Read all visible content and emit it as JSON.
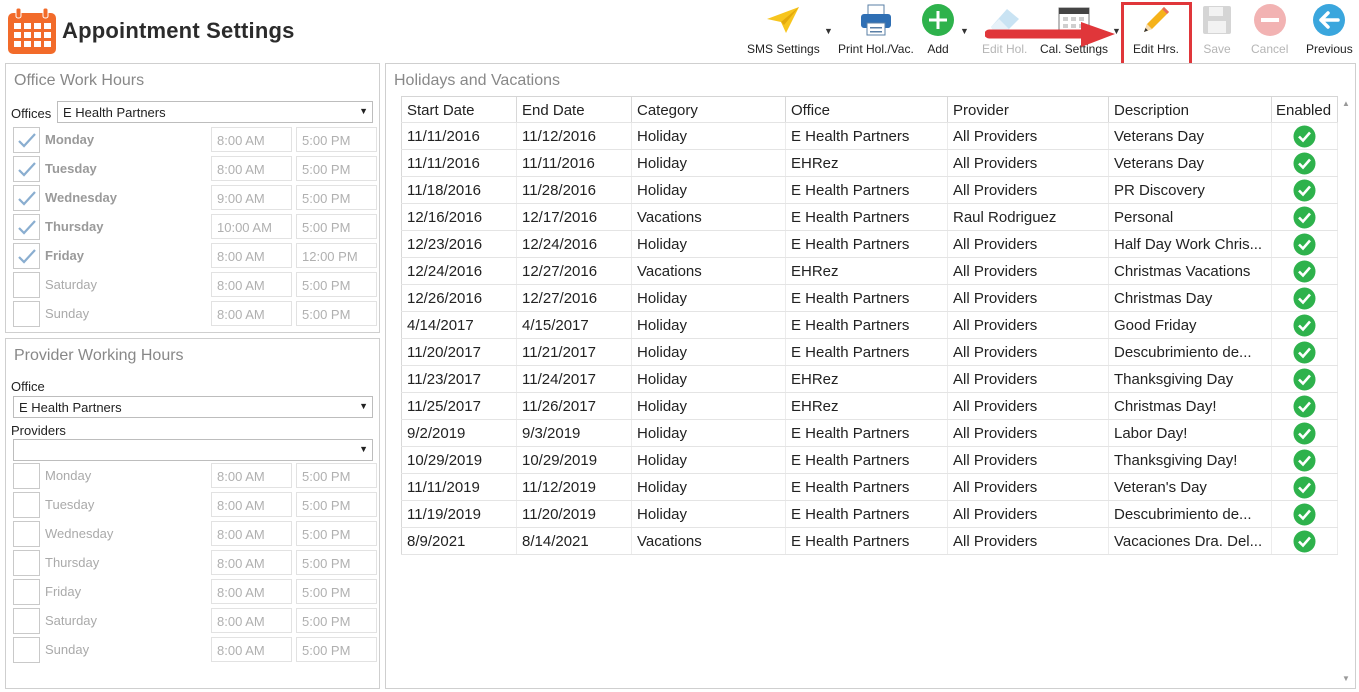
{
  "header": {
    "title": "Appointment Settings"
  },
  "toolbar": [
    {
      "label": "SMS Settings",
      "icon": "paper-plane-icon",
      "enabled": true
    },
    {
      "label": "Print Hol./Vac.",
      "icon": "printer-icon",
      "enabled": true
    },
    {
      "label": "Add",
      "icon": "plus-circle-icon",
      "enabled": true
    },
    {
      "label": "Edit Hol.",
      "icon": "eraser-icon",
      "enabled": false
    },
    {
      "label": "Cal. Settings",
      "icon": "calendar-settings-icon",
      "enabled": true
    },
    {
      "label": "Edit Hrs.",
      "icon": "pencil-icon",
      "enabled": true
    },
    {
      "label": "Save",
      "icon": "floppy-disk-icon",
      "enabled": false
    },
    {
      "label": "Cancel",
      "icon": "cancel-circle-icon",
      "enabled": false
    },
    {
      "label": "Previous",
      "icon": "back-arrow-icon",
      "enabled": true
    }
  ],
  "office_work_hours": {
    "title": "Office Work Hours",
    "offices_label": "Offices",
    "office_value": "E Health Partners",
    "days": [
      {
        "day": "Monday",
        "checked": true,
        "start": "8:00 AM",
        "end": "5:00 PM"
      },
      {
        "day": "Tuesday",
        "checked": true,
        "start": "8:00 AM",
        "end": "5:00 PM"
      },
      {
        "day": "Wednesday",
        "checked": true,
        "start": "9:00 AM",
        "end": "5:00 PM"
      },
      {
        "day": "Thursday",
        "checked": true,
        "start": "10:00 AM",
        "end": "5:00 PM"
      },
      {
        "day": "Friday",
        "checked": true,
        "start": "8:00 AM",
        "end": "12:00 PM"
      },
      {
        "day": "Saturday",
        "checked": false,
        "start": "8:00 AM",
        "end": "5:00 PM"
      },
      {
        "day": "Sunday",
        "checked": false,
        "start": "8:00 AM",
        "end": "5:00 PM"
      }
    ]
  },
  "provider_working_hours": {
    "title": "Provider Working Hours",
    "office_label": "Office",
    "office_value": "E Health Partners",
    "providers_label": "Providers",
    "providers_value": "",
    "days": [
      {
        "day": "Monday",
        "checked": false,
        "start": "8:00 AM",
        "end": "5:00 PM"
      },
      {
        "day": "Tuesday",
        "checked": false,
        "start": "8:00 AM",
        "end": "5:00 PM"
      },
      {
        "day": "Wednesday",
        "checked": false,
        "start": "8:00 AM",
        "end": "5:00 PM"
      },
      {
        "day": "Thursday",
        "checked": false,
        "start": "8:00 AM",
        "end": "5:00 PM"
      },
      {
        "day": "Friday",
        "checked": false,
        "start": "8:00 AM",
        "end": "5:00 PM"
      },
      {
        "day": "Saturday",
        "checked": false,
        "start": "8:00 AM",
        "end": "5:00 PM"
      },
      {
        "day": "Sunday",
        "checked": false,
        "start": "8:00 AM",
        "end": "5:00 PM"
      }
    ]
  },
  "holidays": {
    "title": "Holidays and Vacations",
    "columns": [
      "Start Date",
      "End Date",
      "Category",
      "Office",
      "Provider",
      "Description",
      "Enabled"
    ],
    "rows": [
      [
        "11/11/2016",
        "11/12/2016",
        "Holiday",
        "E Health Partners",
        "All Providers",
        "Veterans Day",
        true
      ],
      [
        "11/11/2016",
        "11/11/2016",
        "Holiday",
        "EHRez",
        "All Providers",
        "Veterans Day",
        true
      ],
      [
        "11/18/2016",
        "11/28/2016",
        "Holiday",
        "E Health Partners",
        "All Providers",
        "PR Discovery",
        true
      ],
      [
        "12/16/2016",
        "12/17/2016",
        "Vacations",
        "E Health Partners",
        "Raul Rodriguez",
        "Personal",
        true
      ],
      [
        "12/23/2016",
        "12/24/2016",
        "Holiday",
        "E Health Partners",
        "All Providers",
        "Half Day Work Chris...",
        true
      ],
      [
        "12/24/2016",
        "12/27/2016",
        "Vacations",
        "EHRez",
        "All Providers",
        "Christmas Vacations",
        true
      ],
      [
        "12/26/2016",
        "12/27/2016",
        "Holiday",
        "E Health Partners",
        "All Providers",
        "Christmas Day",
        true
      ],
      [
        "4/14/2017",
        "4/15/2017",
        "Holiday",
        "E Health Partners",
        "All Providers",
        "Good Friday",
        true
      ],
      [
        "11/20/2017",
        "11/21/2017",
        "Holiday",
        "E Health Partners",
        "All Providers",
        "Descubrimiento de...",
        true
      ],
      [
        "11/23/2017",
        "11/24/2017",
        "Holiday",
        "EHRez",
        "All Providers",
        "Thanksgiving Day",
        true
      ],
      [
        "11/25/2017",
        "11/26/2017",
        "Holiday",
        "EHRez",
        "All Providers",
        "Christmas Day!",
        true
      ],
      [
        "9/2/2019",
        "9/3/2019",
        "Holiday",
        "E Health Partners",
        "All Providers",
        "Labor Day!",
        true
      ],
      [
        "10/29/2019",
        "10/29/2019",
        "Holiday",
        "E Health Partners",
        "All Providers",
        "Thanksgiving Day!",
        true
      ],
      [
        "11/11/2019",
        "11/12/2019",
        "Holiday",
        "E Health Partners",
        "All Providers",
        "Veteran's Day",
        true
      ],
      [
        "11/19/2019",
        "11/20/2019",
        "Holiday",
        "E Health Partners",
        "All Providers",
        "Descubrimiento de...",
        true
      ],
      [
        "8/9/2021",
        "8/14/2021",
        "Vacations",
        "E Health Partners",
        "All Providers",
        "Vacaciones Dra. Del...",
        true
      ]
    ]
  },
  "colors": {
    "accent_orange": "#f26b2a",
    "enabled_green": "#2eb24c",
    "highlight_red": "#e0363a"
  }
}
